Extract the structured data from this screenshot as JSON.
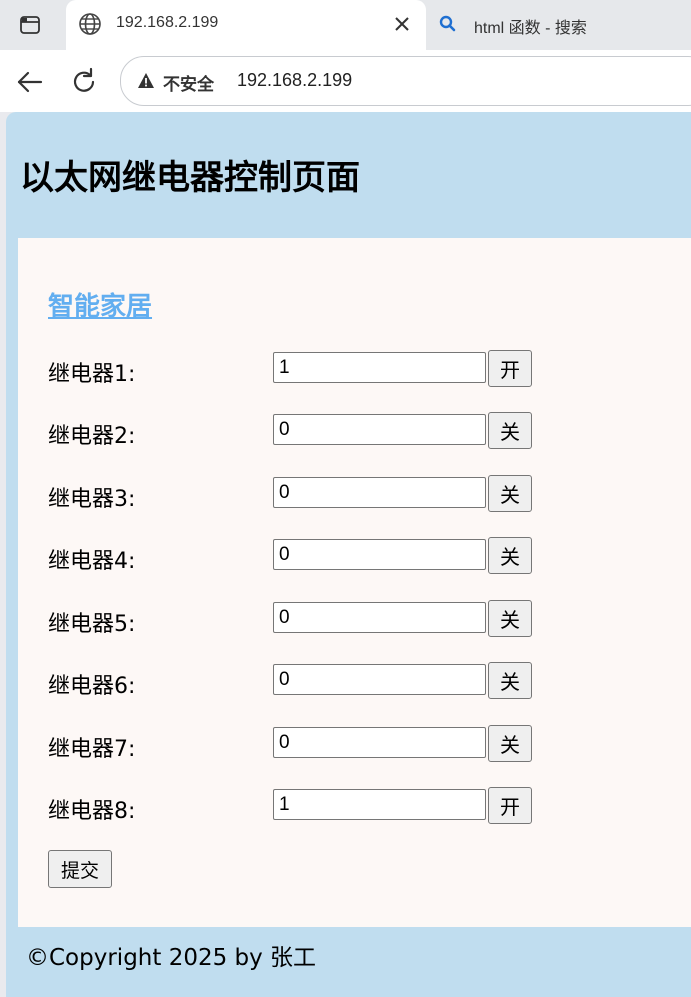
{
  "browser": {
    "active_tab": {
      "title": "192.168.2.199",
      "favicon": "globe-icon"
    },
    "inactive_tab": {
      "title": "html 函数 - 搜索",
      "favicon": "search-icon"
    },
    "address_bar": {
      "security_label": "不安全",
      "url": "192.168.2.199"
    }
  },
  "page": {
    "heading": "以太网继电器控制页面",
    "section_link": "智能家居",
    "relays": [
      {
        "label": "继电器1:",
        "value": "1",
        "button": "开"
      },
      {
        "label": "继电器2:",
        "value": "0",
        "button": "关"
      },
      {
        "label": "继电器3:",
        "value": "0",
        "button": "关"
      },
      {
        "label": "继电器4:",
        "value": "0",
        "button": "关"
      },
      {
        "label": "继电器5:",
        "value": "0",
        "button": "关"
      },
      {
        "label": "继电器6:",
        "value": "0",
        "button": "关"
      },
      {
        "label": "继电器7:",
        "value": "0",
        "button": "关"
      },
      {
        "label": "继电器8:",
        "value": "1",
        "button": "开"
      }
    ],
    "submit_label": "提交",
    "footer": "©Copyright 2025 by 张工"
  },
  "colors": {
    "page_background": "#c0ddef",
    "panel_background": "#fdf8f6",
    "link": "#62aef0"
  }
}
